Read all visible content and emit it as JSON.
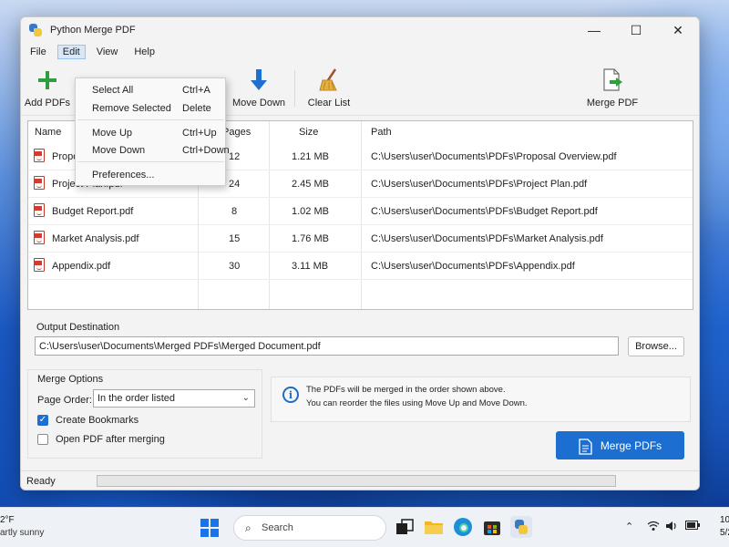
{
  "window": {
    "title": "Python Merge PDF",
    "minimize_glyph": "—",
    "maximize_glyph": "☐",
    "close_glyph": "✕"
  },
  "menubar": {
    "items": [
      "File",
      "Edit",
      "View",
      "Help"
    ],
    "active": "Edit"
  },
  "toolbar": {
    "add_label": "Add PDFs",
    "move_down_label": "Move Down",
    "clear_list_label": "Clear List",
    "merge_label": "Merge PDF"
  },
  "edit_menu": {
    "items": [
      {
        "label": "Select All",
        "shortcut": "Ctrl+A"
      },
      {
        "label": "Remove Selected",
        "shortcut": "Delete"
      },
      {
        "label": "Move Up",
        "shortcut": "Ctrl+Up"
      },
      {
        "label": "Move Down",
        "shortcut": "Ctrl+Down"
      },
      {
        "label": "Preferences...",
        "shortcut": ""
      }
    ]
  },
  "table": {
    "headers": {
      "name": "Name",
      "pages": "Pages",
      "size": "Size",
      "path": "Path"
    },
    "rows": [
      {
        "name": "Proposal Overview.pdf",
        "pages": "12",
        "size": "1.21 MB",
        "path": "C:\\Users\\user\\Documents\\PDFs\\Proposal Overview.pdf"
      },
      {
        "name": "Project Plan.pdf",
        "pages": "24",
        "size": "2.45 MB",
        "path": "C:\\Users\\user\\Documents\\PDFs\\Project Plan.pdf"
      },
      {
        "name": "Budget Report.pdf",
        "pages": "8",
        "size": "1.02 MB",
        "path": "C:\\Users\\user\\Documents\\PDFs\\Budget Report.pdf"
      },
      {
        "name": "Market Analysis.pdf",
        "pages": "15",
        "size": "1.76 MB",
        "path": "C:\\Users\\user\\Documents\\PDFs\\Market Analysis.pdf"
      },
      {
        "name": "Appendix.pdf",
        "pages": "30",
        "size": "3.11 MB",
        "path": "C:\\Users\\user\\Documents\\PDFs\\Appendix.pdf"
      }
    ]
  },
  "output": {
    "label": "Output Destination",
    "value": "C:\\Users\\user\\Documents\\Merged PDFs\\Merged Document.pdf",
    "browse_label": "Browse..."
  },
  "merge_options": {
    "title": "Merge Options",
    "page_order_label": "Page Order:",
    "page_order_value": "In the order listed",
    "create_bookmarks_label": "Create Bookmarks",
    "create_bookmarks_checked": true,
    "open_after_label": "Open PDF after merging",
    "open_after_checked": false
  },
  "info": {
    "line1": "The PDFs will be merged in the order shown above.",
    "line2": "You can reorder the files using Move Up and Move Down."
  },
  "merge_button_label": "Merge PDFs",
  "status": {
    "text": "Ready",
    "progress": 0
  },
  "taskbar": {
    "weather_temp": "2°F",
    "weather_desc": "artly sunny",
    "search_placeholder": "Search",
    "clock_time": "10",
    "clock_date": "5/2"
  },
  "colors": {
    "accent": "#1c6fd1",
    "add_icon": "#2e9e3e",
    "move_down_icon": "#1f6fd1"
  }
}
